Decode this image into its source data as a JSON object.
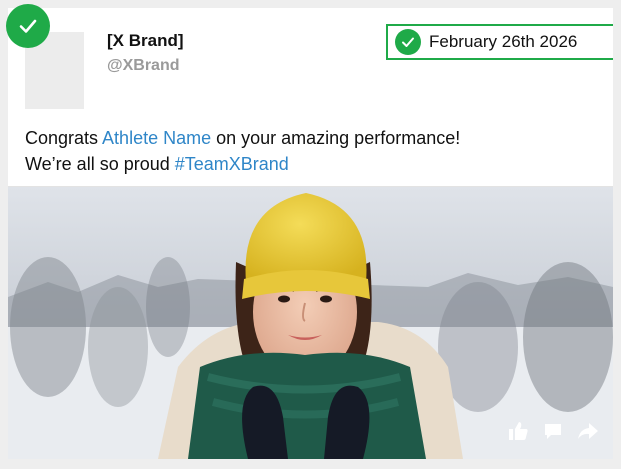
{
  "post": {
    "brand_name": "[X Brand]",
    "handle": "@XBrand",
    "date": "February 26th 2026",
    "text_line1_pre": "Congrats ",
    "text_line1_link": "Athlete Name",
    "text_line1_post": " on your amazing performance!",
    "text_line2_pre": "We’re all so proud ",
    "text_line2_hashtag": "#TeamXBrand"
  },
  "icons": {
    "approved": "check-icon",
    "like": "thumbs-up-icon",
    "comment": "comment-icon",
    "share": "share-icon"
  },
  "colors": {
    "approved_green": "#1faa48",
    "link_blue": "#2f86c8",
    "handle_gray": "#9a9a9a"
  }
}
